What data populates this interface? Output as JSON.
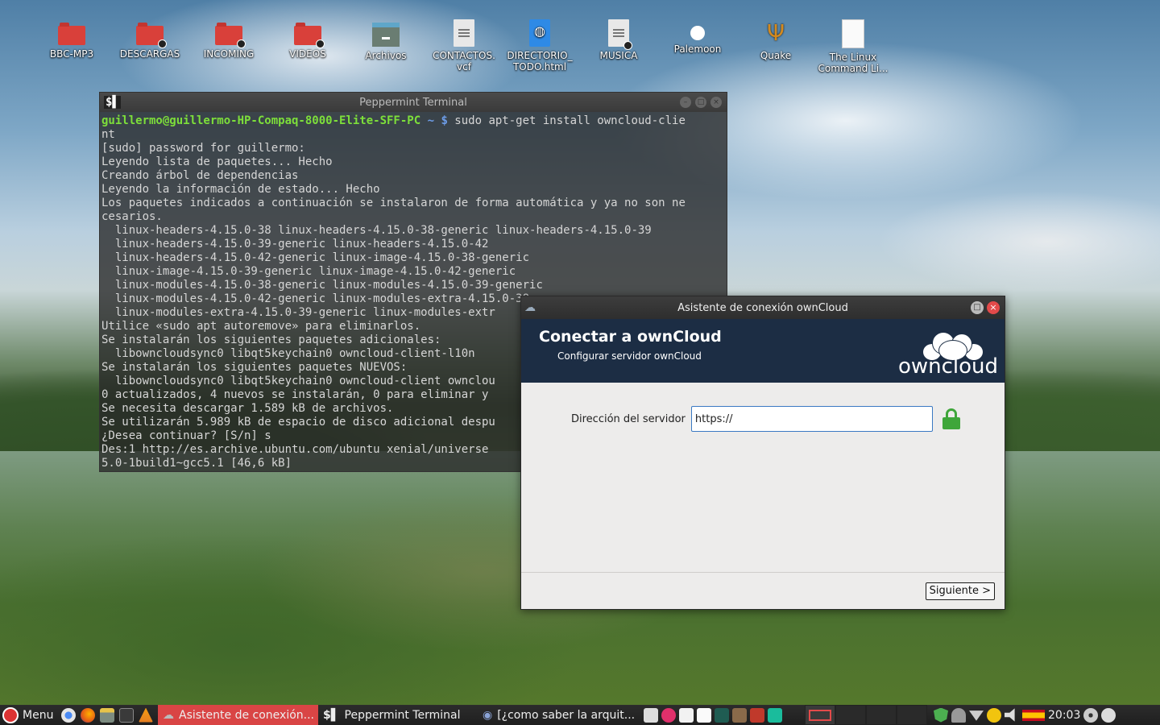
{
  "desktop": {
    "icons": [
      {
        "label": "BBC-MP3",
        "icon": "red-folder-icon"
      },
      {
        "label": "DESCARGAS",
        "icon": "red-folder-icon"
      },
      {
        "label": "INCOMING",
        "icon": "red-folder-icon"
      },
      {
        "label": "VIDEOS",
        "icon": "red-folder-icon"
      },
      {
        "label": "Archivos",
        "icon": "archive-icon"
      },
      {
        "label": "CONTACTOS.\nvcf",
        "icon": "document-icon"
      },
      {
        "label": "DIRECTORIO_\nTODO.html",
        "icon": "html-document-icon"
      },
      {
        "label": "MUSICA",
        "icon": "document-icon"
      },
      {
        "label": "Palemoon",
        "icon": "app-icon"
      },
      {
        "label": "Quake",
        "icon": "quake-icon"
      },
      {
        "label": "The Linux\nCommand Li...",
        "icon": "pdf-document-icon"
      }
    ]
  },
  "terminal": {
    "title": "Peppermint Terminal",
    "prompt_user": "guillermo@guillermo-HP-Compaq-8000-Elite-SFF-PC",
    "prompt_path": " ~ $",
    "command": " sudo apt-get install owncloud-clie",
    "lines": [
      "nt",
      "[sudo] password for guillermo:",
      "Leyendo lista de paquetes... Hecho",
      "Creando árbol de dependencias",
      "Leyendo la información de estado... Hecho",
      "Los paquetes indicados a continuación se instalaron de forma automática y ya no son ne",
      "cesarios.",
      "  linux-headers-4.15.0-38 linux-headers-4.15.0-38-generic linux-headers-4.15.0-39",
      "  linux-headers-4.15.0-39-generic linux-headers-4.15.0-42",
      "  linux-headers-4.15.0-42-generic linux-image-4.15.0-38-generic",
      "  linux-image-4.15.0-39-generic linux-image-4.15.0-42-generic",
      "  linux-modules-4.15.0-38-generic linux-modules-4.15.0-39-generic",
      "  linux-modules-4.15.0-42-generic linux-modules-extra-4.15.0-38",
      "  linux-modules-extra-4.15.0-39-generic linux-modules-extr",
      "Utilice «sudo apt autoremove» para eliminarlos.",
      "Se instalarán los siguientes paquetes adicionales:",
      "  libowncloudsync0 libqt5keychain0 owncloud-client-l10n",
      "Se instalarán los siguientes paquetes NUEVOS:",
      "  libowncloudsync0 libqt5keychain0 owncloud-client ownclou",
      "0 actualizados, 4 nuevos se instalarán, 0 para eliminar y",
      "Se necesita descargar 1.589 kB de archivos.",
      "Se utilizarán 5.989 kB de espacio de disco adicional despu",
      "¿Desea continuar? [S/n] s",
      "Des:1 http://es.archive.ubuntu.com/ubuntu xenial/universe",
      "5.0-1build1~gcc5.1 [46,6 kB]"
    ]
  },
  "dialog": {
    "title": "Asistente de conexión ownCloud",
    "heading": "Conectar a ownCloud",
    "subheading": "Configurar servidor ownCloud",
    "logo_text": "owncloud",
    "server_label": "Dirección del servidor",
    "server_value": "https://",
    "next_button": "Siguiente >",
    "header_bg": "#1c2d44",
    "lock_color": "#3fa63a"
  },
  "taskbar": {
    "menu_label": "Menu",
    "tasks": [
      {
        "label": "Asistente de conexión...",
        "active": true
      },
      {
        "label": "Peppermint Terminal",
        "active": false
      },
      {
        "label": "[¿como saber la arquit...",
        "active": false
      }
    ],
    "clock": "20:03",
    "accent": "#d94545"
  }
}
